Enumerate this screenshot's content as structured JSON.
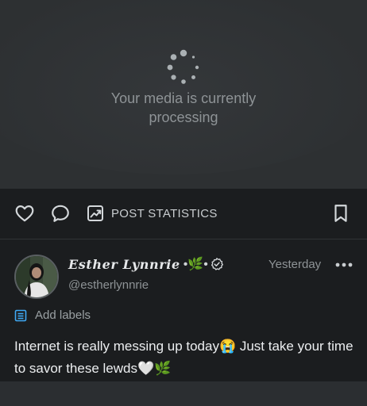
{
  "media": {
    "processing_line1": "Your media is currently",
    "processing_line2": "processing",
    "spinner_icon": "loading-spinner-icon"
  },
  "actions": {
    "like_icon": "heart-icon",
    "comment_icon": "comment-bubble-icon",
    "stats_icon": "chart-trend-icon",
    "stats_label": "POST STATISTICS",
    "bookmark_icon": "bookmark-icon"
  },
  "post": {
    "display_name": "Esther Lynnrie",
    "name_decoration": "•🌿•",
    "verified_icon": "verified-badge-icon",
    "handle": "@estherlynnrie",
    "timestamp": "Yesterday",
    "more_icon": "more-horizontal-icon",
    "labels_icon": "label-list-icon",
    "labels_text": "Add labels",
    "text": "Internet is really messing up today😭 Just take your time to savor these lewds🤍🌿"
  },
  "colors": {
    "media_bg": "#2d3032",
    "page_bg": "#1b1d1f",
    "text_primary": "#eceef0",
    "text_muted": "#8e9396",
    "label_accent": "#3fa9f5"
  }
}
